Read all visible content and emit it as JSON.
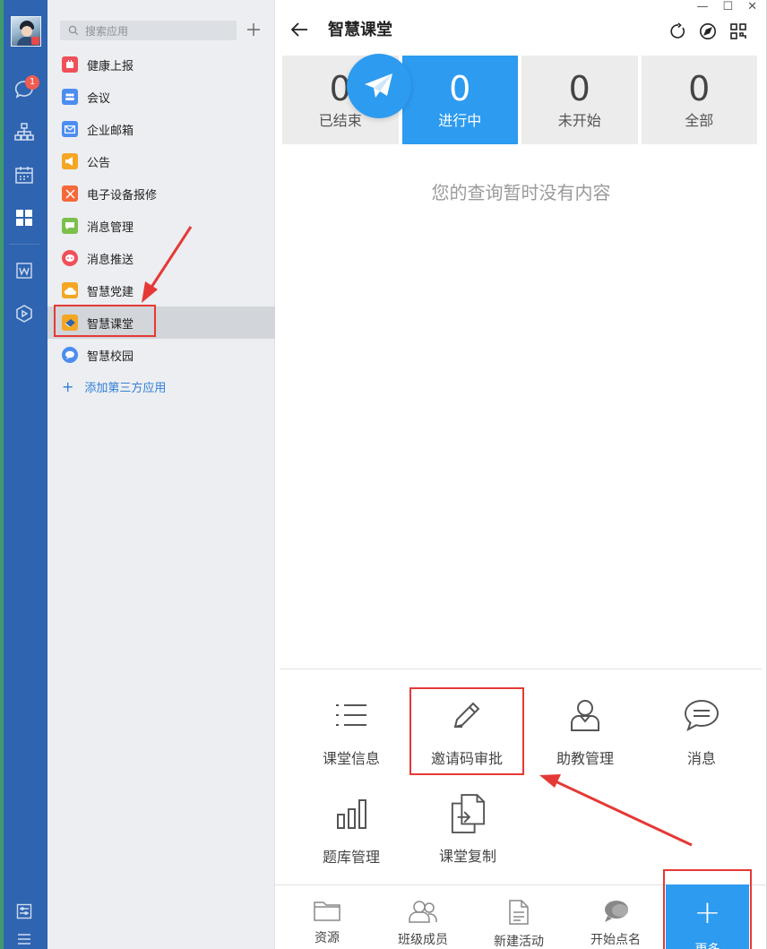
{
  "sidebar": {
    "badge_count": "1",
    "search_placeholder": "搜索应用",
    "apps": [
      {
        "label": "健康上报",
        "color": "#f0505a"
      },
      {
        "label": "会议",
        "color": "#4d8df0"
      },
      {
        "label": "企业邮箱",
        "color": "#4d8df0"
      },
      {
        "label": "公告",
        "color": "#f5a623"
      },
      {
        "label": "电子设备报修",
        "color": "#f4683a"
      },
      {
        "label": "消息管理",
        "color": "#7cc04b"
      },
      {
        "label": "消息推送",
        "color": "#f0505a"
      },
      {
        "label": "智慧党建",
        "color": "#f5a623"
      },
      {
        "label": "智慧课堂",
        "color": "#f5a623"
      },
      {
        "label": "智慧校园",
        "color": "#4d8df0"
      }
    ],
    "add_third": "添加第三方应用"
  },
  "header": {
    "title": "智慧课堂"
  },
  "stats": [
    {
      "num": "0",
      "label": "已结束"
    },
    {
      "num": "0",
      "label": "进行中"
    },
    {
      "num": "0",
      "label": "未开始"
    },
    {
      "num": "0",
      "label": "全部"
    }
  ],
  "empty_text": "您的查询暂时没有内容",
  "functions": [
    {
      "label": "课堂信息",
      "icon": "list-icon"
    },
    {
      "label": "邀请码审批",
      "icon": "pencil-icon"
    },
    {
      "label": "助教管理",
      "icon": "person-icon"
    },
    {
      "label": "消息",
      "icon": "chat-bubble-icon"
    },
    {
      "label": "题库管理",
      "icon": "bar-chart-icon"
    },
    {
      "label": "课堂复制",
      "icon": "copy-document-icon"
    }
  ],
  "bottom_tabs": [
    {
      "label": "资源",
      "icon": "folder-icon"
    },
    {
      "label": "班级成员",
      "icon": "members-icon"
    },
    {
      "label": "新建活动",
      "icon": "document-icon"
    },
    {
      "label": "开始点名",
      "icon": "bubbles-icon"
    }
  ],
  "more": {
    "label": "更多",
    "icon": "plus-icon"
  },
  "colors": {
    "accent": "#2d9bf0",
    "rail": "#2f64b0",
    "highlight": "#e53935"
  }
}
